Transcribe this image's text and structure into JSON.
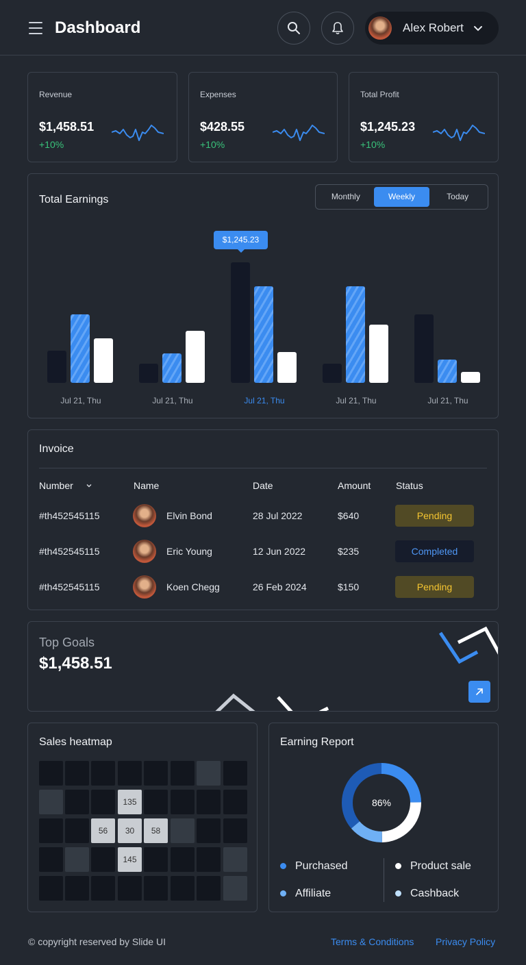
{
  "header": {
    "title": "Dashboard",
    "user_name": "Alex Robert"
  },
  "stats": [
    {
      "label": "Revenue",
      "value": "$1,458.51",
      "change": "+10%"
    },
    {
      "label": "Expenses",
      "value": "$428.55",
      "change": "+10%"
    },
    {
      "label": "Total Profit",
      "value": "$1,245.23",
      "change": "+10%"
    }
  ],
  "earnings": {
    "title": "Total Earnings",
    "tabs": [
      "Monthly",
      "Weekly",
      "Today"
    ],
    "active_tab": "Weekly",
    "tooltip": "$1,245.23",
    "colors": {
      "dark": "#131826",
      "blue": "#3b8cf0",
      "white": "#ffffff"
    }
  },
  "chart_data": {
    "type": "bar",
    "categories": [
      "Jul 21, Thu",
      "Jul 21, Thu",
      "Jul 21, Thu",
      "Jul 21, Thu",
      "Jul 21, Thu"
    ],
    "highlighted_category_index": 2,
    "series": [
      {
        "values": [
          48,
          28,
          178,
          28,
          101
        ]
      },
      {
        "values": [
          101,
          43,
          143,
          143,
          34
        ]
      },
      {
        "values": [
          66,
          77,
          46,
          86,
          16
        ]
      }
    ],
    "ylim": [
      0,
      180
    ],
    "grid": false
  },
  "invoice": {
    "title": "Invoice",
    "columns": [
      "Number",
      "Name",
      "Date",
      "Amount",
      "Status"
    ],
    "rows": [
      {
        "number": "#th452545115",
        "name": "Elvin Bond",
        "date": "28 Jul 2022",
        "amount": "$640",
        "status": "Pending"
      },
      {
        "number": "#th452545115",
        "name": "Eric Young",
        "date": "12 Jun 2022",
        "amount": "$235",
        "status": "Completed"
      },
      {
        "number": "#th452545115",
        "name": "Koen Chegg",
        "date": "26 Feb 2024",
        "amount": "$150",
        "status": "Pending"
      }
    ]
  },
  "goals": {
    "label": "Top Goals",
    "value": "$1,458.51"
  },
  "heatmap": {
    "title": "Sales heatmap",
    "grid": [
      [
        0,
        0,
        0,
        0,
        0,
        0,
        1,
        0
      ],
      [
        1,
        0,
        0,
        "135",
        0,
        0,
        0,
        0
      ],
      [
        0,
        0,
        "56",
        "30",
        "58",
        1,
        0,
        0
      ],
      [
        0,
        1,
        0,
        "145",
        0,
        0,
        0,
        1
      ],
      [
        0,
        0,
        0,
        0,
        0,
        0,
        0,
        1
      ]
    ]
  },
  "report": {
    "title": "Earning Report",
    "percent": "86%",
    "legend": [
      {
        "label": "Purchased",
        "color": "#3b8cf0"
      },
      {
        "label": "Product sale",
        "color": "#ffffff"
      },
      {
        "label": "Affiliate",
        "color": "#6fb0f5"
      },
      {
        "label": "Cashback",
        "color": "#bfe0fb"
      }
    ]
  },
  "footer": {
    "copyright": "© copyright reserved by Slide UI",
    "terms": "Terms & Conditions",
    "privacy": "Privacy Policy"
  }
}
